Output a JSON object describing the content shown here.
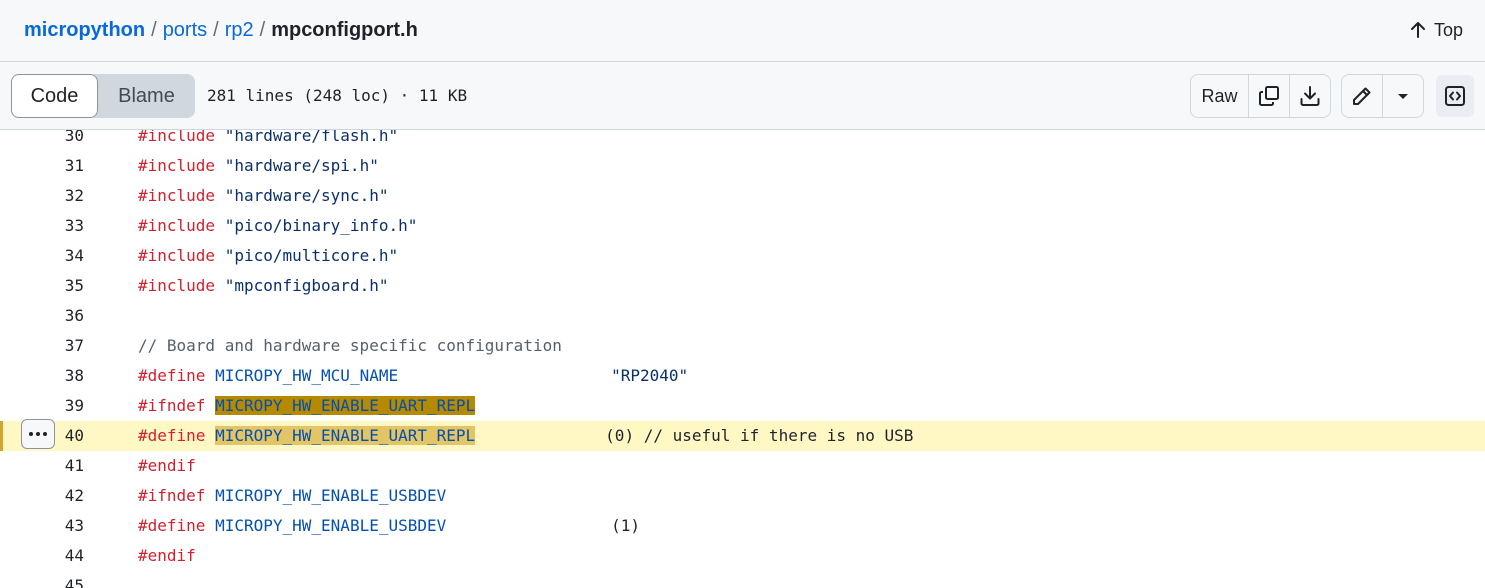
{
  "breadcrumb": {
    "repo": "micropython",
    "path": [
      "ports",
      "rp2"
    ],
    "separator": "/",
    "file": "mpconfigport.h"
  },
  "top_link": {
    "label": "Top",
    "icon": "arrow-up-icon"
  },
  "toolbar": {
    "tabs": [
      {
        "label": "Code",
        "selected": true
      },
      {
        "label": "Blame",
        "selected": false
      }
    ],
    "file_info": "281 lines (248 loc) · 11 KB",
    "raw_label": "Raw",
    "icons": [
      "copy-icon",
      "download-icon",
      "pencil-icon",
      "triangle-down-icon",
      "code-square-icon"
    ]
  },
  "code": {
    "lines": [
      {
        "num": "30",
        "directive": "#include",
        "arg": "\"hardware/flash.h\""
      },
      {
        "num": "31",
        "directive": "#include",
        "arg": "\"hardware/spi.h\""
      },
      {
        "num": "32",
        "directive": "#include",
        "arg": "\"hardware/sync.h\""
      },
      {
        "num": "33",
        "directive": "#include",
        "arg": "\"pico/binary_info.h\""
      },
      {
        "num": "34",
        "directive": "#include",
        "arg": "\"pico/multicore.h\""
      },
      {
        "num": "35",
        "directive": "#include",
        "arg": "\"mpconfigboard.h\""
      },
      {
        "num": "36"
      },
      {
        "num": "37",
        "comment": "// Board and hardware specific configuration"
      },
      {
        "num": "38",
        "directive": "#define",
        "name": "MICROPY_HW_MCU_NAME",
        "value": "\"RP2040\""
      },
      {
        "num": "39",
        "directive": "#ifndef",
        "name": "MICROPY_HW_ENABLE_UART_REPL"
      },
      {
        "num": "40",
        "directive": "#define",
        "name": "MICROPY_HW_ENABLE_UART_REPL",
        "value": "(0) // useful if there is no USB",
        "highlighted": true
      },
      {
        "num": "41",
        "directive": "#endif"
      },
      {
        "num": "42",
        "directive": "#ifndef",
        "name": "MICROPY_HW_ENABLE_USBDEV"
      },
      {
        "num": "43",
        "directive": "#define",
        "name": "MICROPY_HW_ENABLE_USBDEV",
        "value": "(1)"
      },
      {
        "num": "44",
        "directive": "#endif"
      },
      {
        "num": "45"
      }
    ]
  },
  "colors": {
    "link": "#0969da",
    "keyword": "#cf222e",
    "macro": "#0550ae",
    "string": "#0a3069",
    "line_highlight": "#fff8c5",
    "selection_match": "#b58900"
  }
}
